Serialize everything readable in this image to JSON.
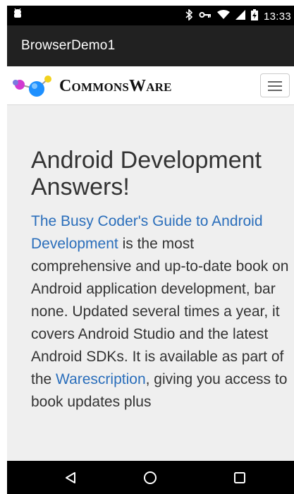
{
  "status_bar": {
    "time": "13:33",
    "icons": [
      "android-debug-icon",
      "bluetooth-icon",
      "vpn-key-icon",
      "wifi-icon",
      "signal-icon",
      "battery-icon"
    ]
  },
  "app_bar": {
    "title": "BrowserDemo1"
  },
  "site_header": {
    "logo_text": "CommonsWare",
    "menu_icon": "hamburger-menu-icon"
  },
  "content": {
    "headline": "Android Development Answers!",
    "link_book": "The Busy Coder's Guide to Android Development",
    "text_after_book": " is the most comprehensive and up-to-date book on Android application development, bar none. Updated several times a year, it covers Android Studio and the latest Android SDKs. It is available as part of the ",
    "link_warescription": "Warescription",
    "text_after_warescription": ", giving you access to book updates plus"
  },
  "nav_bar": {
    "back_icon": "back-triangle-icon",
    "home_icon": "home-circle-icon",
    "recents_icon": "recents-square-icon"
  },
  "colors": {
    "status_bar": "#000000",
    "app_bar": "#212121",
    "page_background": "#efefef",
    "link": "#2a6ebb",
    "text": "#333333"
  }
}
